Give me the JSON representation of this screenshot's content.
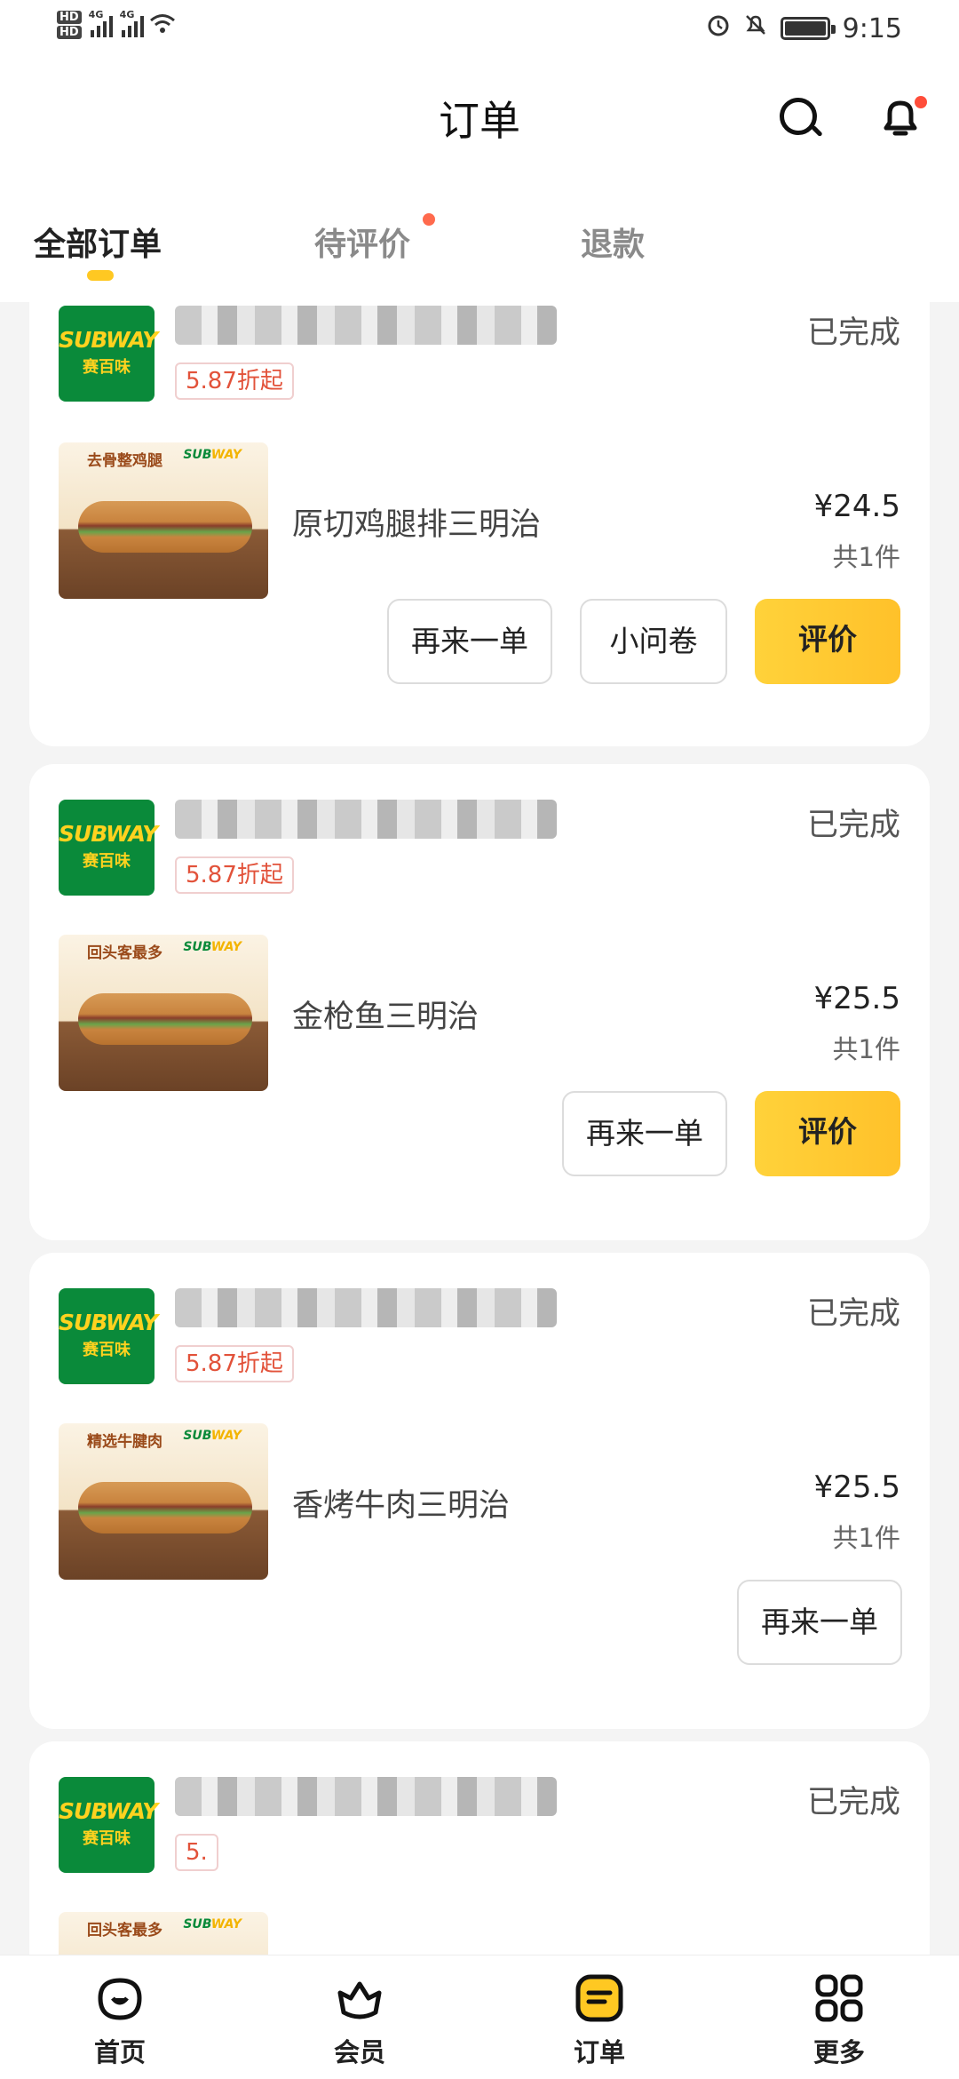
{
  "status_bar": {
    "time": "9:15",
    "network_left": "4G",
    "network_right": "4G",
    "hd1": "HD",
    "hd2": "HD"
  },
  "header": {
    "title": "订单"
  },
  "tabs": [
    {
      "label": "全部订单",
      "active": true
    },
    {
      "label": "待评价",
      "has_dot": true
    },
    {
      "label": "退款"
    }
  ],
  "orders": [
    {
      "logo": {
        "brand": "SUBWAY",
        "cn": "赛百味"
      },
      "status": "已完成",
      "discount": "5.87折起",
      "product": {
        "name": "原切鸡腿排三明治",
        "tag": "去骨整鸡腿",
        "price": "¥24.5",
        "qty": "共1件"
      },
      "buttons": [
        "再来一单",
        "小问卷",
        "评价"
      ]
    },
    {
      "logo": {
        "brand": "SUBWAY",
        "cn": "赛百味"
      },
      "status": "已完成",
      "discount": "5.87折起",
      "product": {
        "name": "金枪鱼三明治",
        "tag": "回头客最多",
        "price": "¥25.5",
        "qty": "共1件"
      },
      "buttons": [
        "再来一单",
        "评价"
      ]
    },
    {
      "logo": {
        "brand": "SUBWAY",
        "cn": "赛百味"
      },
      "status": "已完成",
      "discount": "5.87折起",
      "product": {
        "name": "香烤牛肉三明治",
        "tag": "精选牛腱肉",
        "price": "¥25.5",
        "qty": "共1件"
      },
      "buttons": [
        "再来一单"
      ]
    },
    {
      "logo": {
        "brand": "SUBWAY",
        "cn": "赛百味"
      },
      "status": "已完成",
      "discount": "5.",
      "product": {
        "tag": "回头客最多"
      }
    }
  ],
  "bottom_nav": [
    {
      "label": "首页",
      "icon": "home-icon"
    },
    {
      "label": "会员",
      "icon": "member-crown-icon"
    },
    {
      "label": "订单",
      "icon": "order-icon",
      "active": true
    },
    {
      "label": "更多",
      "icon": "more-grid-icon"
    }
  ],
  "colors": {
    "accent": "#ffc822",
    "subway_green": "#0a8a3a",
    "discount_red": "#e2523a",
    "badge_dot": "#ff4d3a"
  }
}
